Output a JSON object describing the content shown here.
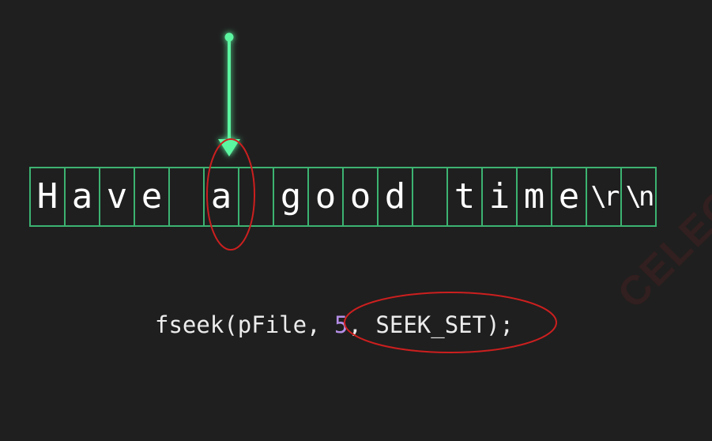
{
  "cells": [
    "H",
    "a",
    "v",
    "e",
    " ",
    "a",
    " ",
    "g",
    "o",
    "o",
    "d",
    " ",
    "t",
    "i",
    "m",
    "e",
    "\\r",
    "\\n"
  ],
  "code": {
    "func": "fseek",
    "open_paren": "(",
    "arg_file": "pFile",
    "sep1": ", ",
    "arg_offset": "5",
    "sep2": ", ",
    "arg_origin": "SEEK_SET",
    "close": ");"
  },
  "highlight_index": 5,
  "watermark": "CELEOS",
  "colors": {
    "background": "#1f1f1f",
    "cell_border": "#3cb371",
    "arrow": "#5cf5a0",
    "ellipse": "#cc1f1f",
    "number": "#b48ee6",
    "text": "#ffffff"
  }
}
